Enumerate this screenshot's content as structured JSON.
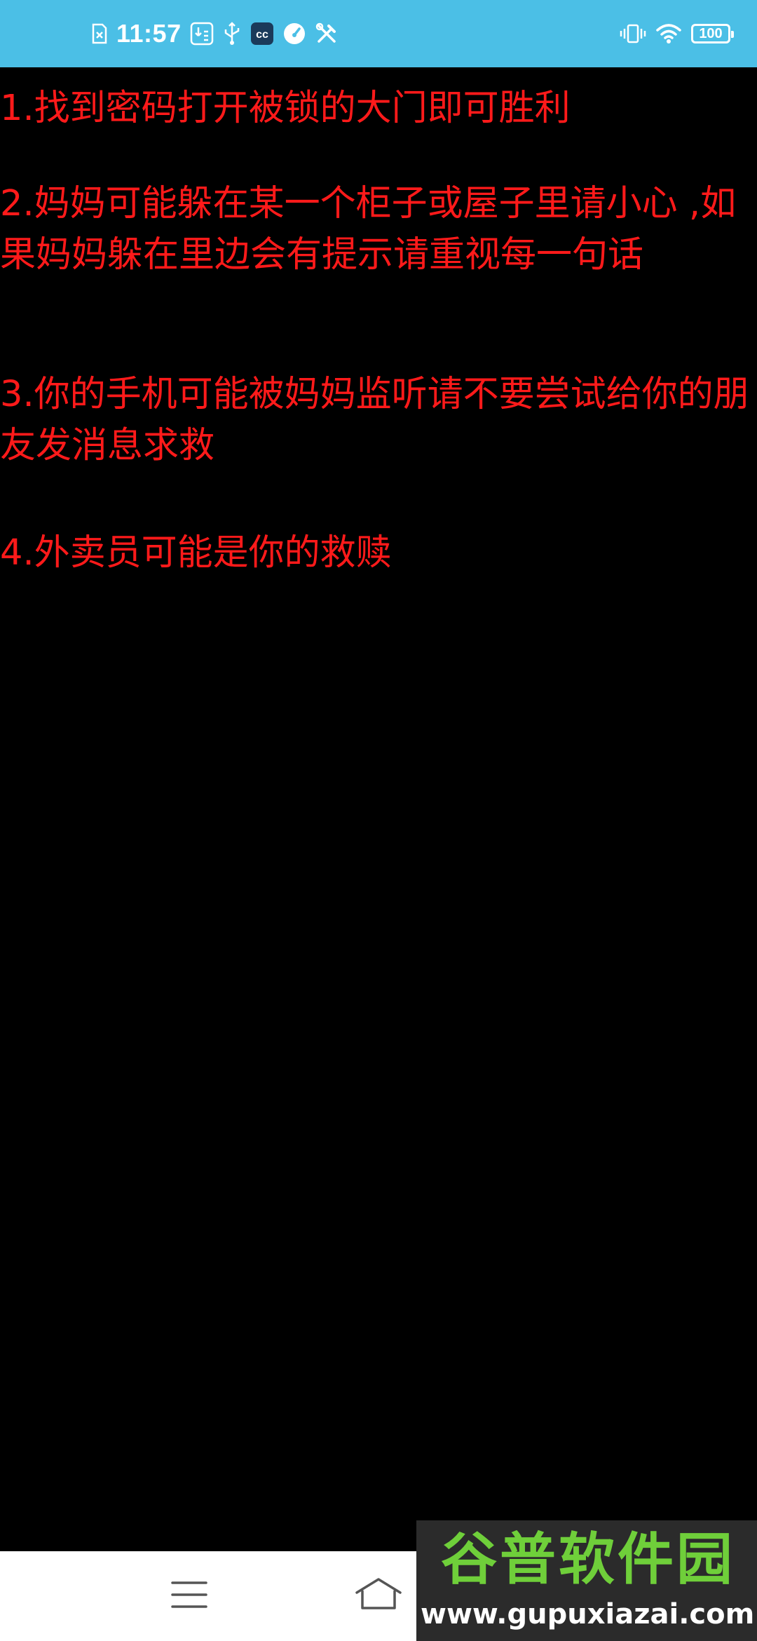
{
  "status_bar": {
    "time": "11:57",
    "battery_level": "100",
    "left_icons": [
      "sim-card-icon",
      "usb-debug-icon",
      "usb-icon",
      "app-cc-icon",
      "speedometer-icon",
      "tools-icon"
    ],
    "right_icons": [
      "vibrate-icon",
      "wifi-icon",
      "battery-icon"
    ],
    "background_color": "#4bbfe6"
  },
  "rules": [
    "1.找到密码打开被锁的大门即可胜利",
    "2.妈妈可能躲在某一个柜子或屋子里请小心 ,如果妈妈躲在里边会有提示请重视每一句话",
    "3.你的手机可能被妈妈监听请不要尝试给你的朋友发消息求救",
    "4.外卖员可能是你的救赎"
  ],
  "rules_text_color": "#ff1a1a",
  "nav_bar": {
    "buttons": [
      "menu-icon",
      "home-icon"
    ]
  },
  "watermark": {
    "logo_text": "谷普软件园",
    "url": "www.gupuxiazai.com"
  }
}
